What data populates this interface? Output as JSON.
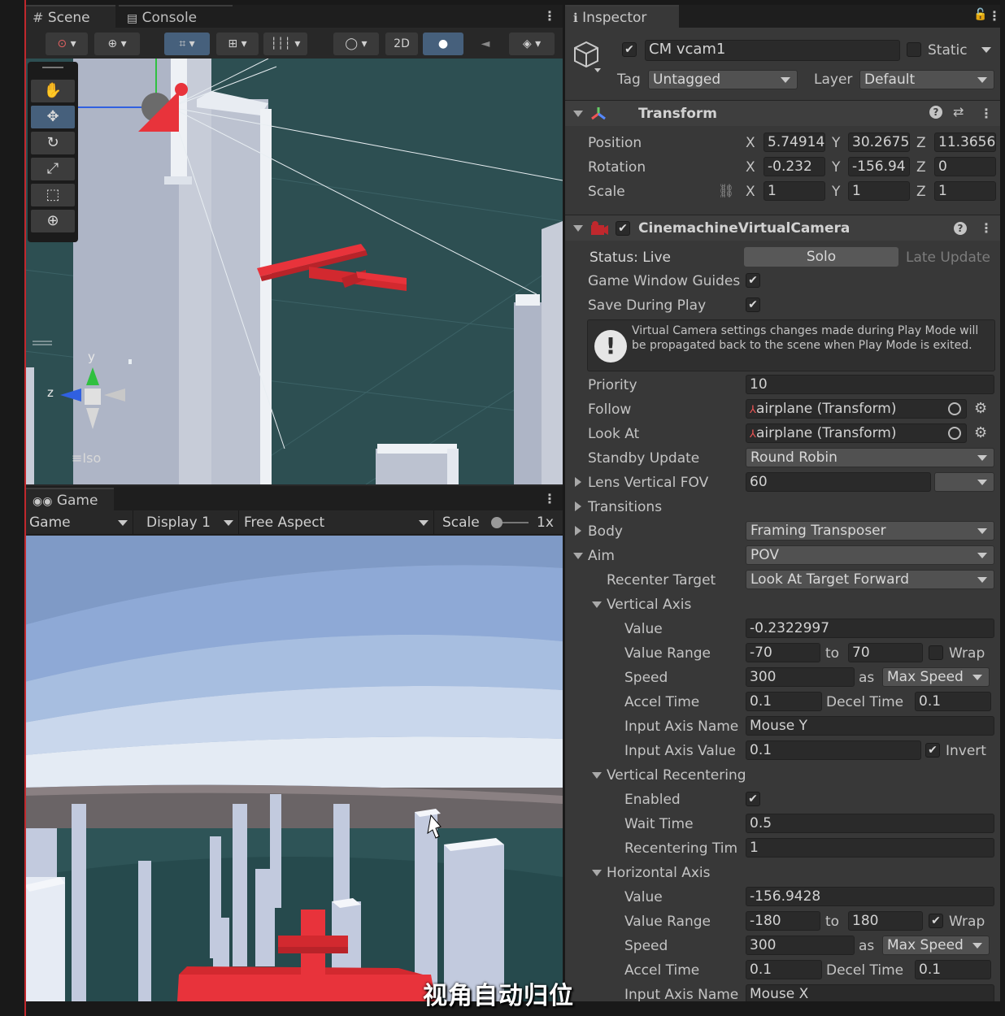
{
  "scene_panel": {
    "tabs": [
      {
        "label": "Scene"
      },
      {
        "label": "Console"
      }
    ],
    "toolbar": {
      "mode_2d": "2D"
    },
    "gizmo": {
      "y_label": "y",
      "z_label": "z",
      "projection": "Iso"
    }
  },
  "game_panel": {
    "tab_label": "Game",
    "toolbar": {
      "view": "Game",
      "display": "Display 1",
      "aspect": "Free Aspect",
      "scale_label": "Scale",
      "scale_value": "1x"
    }
  },
  "inspector": {
    "tab_label": "Inspector",
    "object": {
      "name": "CM vcam1",
      "static_label": "Static",
      "tag_label": "Tag",
      "tag": "Untagged",
      "layer_label": "Layer",
      "layer": "Default"
    },
    "transform": {
      "title": "Transform",
      "rows": [
        {
          "label": "Position",
          "x": "5.74914",
          "y": "30.2675",
          "z": "11.3656"
        },
        {
          "label": "Rotation",
          "x": "-0.232",
          "y": "-156.94",
          "z": "0"
        },
        {
          "label": "Scale",
          "x": "1",
          "y": "1",
          "z": "1"
        }
      ],
      "axis_x": "X",
      "axis_y": "Y",
      "axis_z": "Z"
    },
    "vcam": {
      "title": "CinemachineVirtualCamera",
      "status": "Status: Live",
      "solo": "Solo",
      "late_update": "Late Update",
      "game_window_guides": "Game Window Guides",
      "save_during_play": "Save During Play",
      "help_text": "Virtual Camera settings changes made during Play Mode will be propagated back to the scene when Play Mode is exited.",
      "priority_label": "Priority",
      "priority": "10",
      "follow_label": "Follow",
      "follow": "airplane (Transform)",
      "look_at_label": "Look At",
      "look_at": "airplane (Transform)",
      "standby_label": "Standby Update",
      "standby": "Round Robin",
      "fov_label": "Lens Vertical FOV",
      "fov": "60",
      "transitions_label": "Transitions",
      "body_label": "Body",
      "body": "Framing Transposer",
      "aim_label": "Aim",
      "aim": "POV",
      "recenter_target_label": "Recenter Target",
      "recenter_target": "Look At Target Forward",
      "vertical_axis": {
        "title": "Vertical Axis",
        "value_label": "Value",
        "value": "-0.2322997",
        "range_label": "Value Range",
        "range_min": "-70",
        "to": "to",
        "range_max": "70",
        "wrap_label": "Wrap",
        "speed_label": "Speed",
        "speed": "300",
        "as": "as",
        "speed_mode": "Max Speed",
        "accel_label": "Accel Time",
        "accel": "0.1",
        "decel_label": "Decel Time",
        "decel": "0.1",
        "input_name_label": "Input Axis Name",
        "input_name": "Mouse Y",
        "input_value_label": "Input Axis Value",
        "input_value": "0.1",
        "invert_label": "Invert"
      },
      "vertical_recentering": {
        "title": "Vertical Recentering",
        "enabled_label": "Enabled",
        "wait_label": "Wait Time",
        "wait": "0.5",
        "recenter_time_label": "Recentering Tim",
        "recenter_time": "1"
      },
      "horizontal_axis": {
        "title": "Horizontal Axis",
        "value_label": "Value",
        "value": "-156.9428",
        "range_label": "Value Range",
        "range_min": "-180",
        "to": "to",
        "range_max": "180",
        "wrap_label": "Wrap",
        "speed_label": "Speed",
        "speed": "300",
        "as": "as",
        "speed_mode": "Max Speed",
        "accel_label": "Accel Time",
        "accel": "0.1",
        "decel_label": "Decel Time",
        "decel": "0.1",
        "input_name_label": "Input Axis Name",
        "input_name": "Mouse X"
      }
    }
  },
  "overlay": {
    "subtitle": "视角自动归位"
  },
  "colors": {
    "accent_blue": "#46607c",
    "airplane_red": "#e8333b",
    "panel_bg": "#383838"
  }
}
